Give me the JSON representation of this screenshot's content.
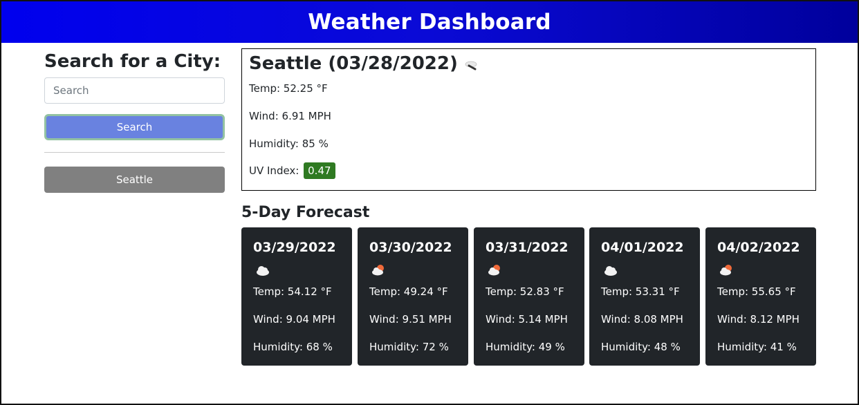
{
  "header": {
    "title": "Weather Dashboard"
  },
  "sidebar": {
    "heading": "Search for a City:",
    "search_placeholder": "Search",
    "search_value": "",
    "search_button": "Search",
    "history": [
      "Seattle"
    ]
  },
  "current": {
    "title": "Seattle (03/28/2022)",
    "icon": "cloud-rain-icon",
    "temp": "Temp: 52.25 °F",
    "wind": "Wind: 6.91 MPH",
    "humidity": "Humidity: 85 %",
    "uv_label": "UV Index:",
    "uv_value": "0.47",
    "uv_color": "#2f7a22"
  },
  "forecast": {
    "title": "5-Day Forecast",
    "days": [
      {
        "date": "03/29/2022",
        "icon": "cloud-icon",
        "temp": "Temp: 54.12 °F",
        "wind": "Wind: 9.04 MPH",
        "humidity": "Humidity: 68 %"
      },
      {
        "date": "03/30/2022",
        "icon": "sun-cloud-icon",
        "temp": "Temp: 49.24 °F",
        "wind": "Wind: 9.51 MPH",
        "humidity": "Humidity: 72 %"
      },
      {
        "date": "03/31/2022",
        "icon": "sun-cloud-icon",
        "temp": "Temp: 52.83 °F",
        "wind": "Wind: 5.14 MPH",
        "humidity": "Humidity: 49 %"
      },
      {
        "date": "04/01/2022",
        "icon": "cloud-icon",
        "temp": "Temp: 53.31 °F",
        "wind": "Wind: 8.08 MPH",
        "humidity": "Humidity: 48 %"
      },
      {
        "date": "04/02/2022",
        "icon": "sun-cloud-icon",
        "temp": "Temp: 55.65 °F",
        "wind": "Wind: 8.12 MPH",
        "humidity": "Humidity: 41 %"
      }
    ]
  },
  "colors": {
    "header_start": "#0000ee",
    "header_end": "#00009c",
    "search_button": "#6982e0",
    "history_button": "#808080",
    "card_bg": "#212529"
  }
}
